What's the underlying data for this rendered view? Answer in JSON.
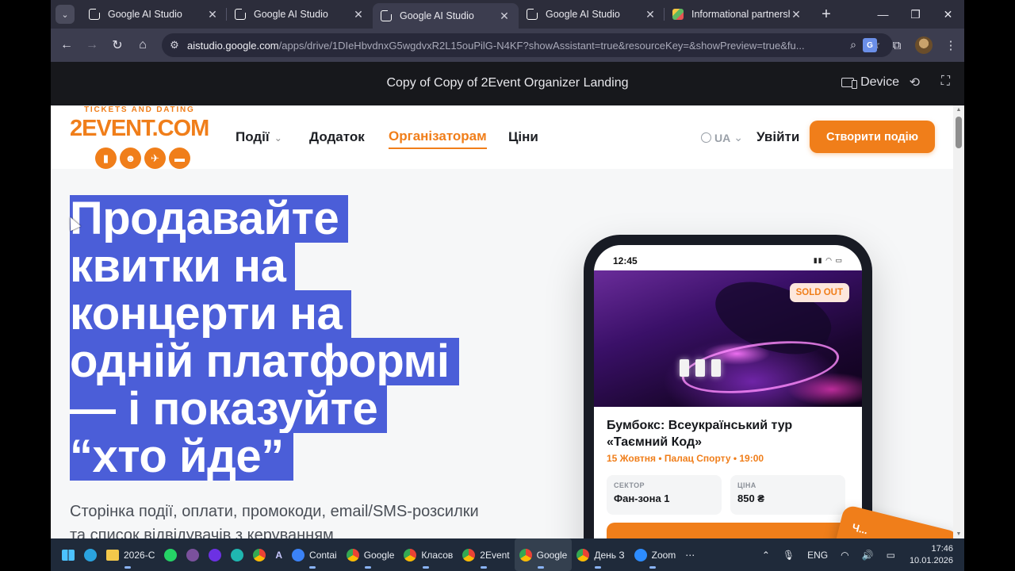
{
  "browser": {
    "tabs": [
      {
        "title": "Google AI Studio",
        "active": false
      },
      {
        "title": "Google AI Studio",
        "active": false
      },
      {
        "title": "Google AI Studio",
        "active": true
      },
      {
        "title": "Google AI Studio",
        "active": false
      },
      {
        "title": "Informational partnership",
        "active": false
      }
    ],
    "url_host": "aistudio.google.com",
    "url_path": "/apps/drive/1DIeHbvdnxG5wgdvxR2L15ouPilG-N4KF?showAssistant=true&resourceKey=&showPreview=true&fu..."
  },
  "preview": {
    "title": "Copy of Copy of 2Event Organizer Landing",
    "device_label": "Device"
  },
  "site": {
    "logo_tagline": "TICKETS AND DATING",
    "logo_text": "2EVENT.COM",
    "nav": {
      "events": "Події",
      "app": "Додаток",
      "organizers": "Організаторам",
      "prices": "Ціни"
    },
    "lang": "UA",
    "login": "Увійти",
    "cta": "Створити подію",
    "hero_lines": [
      "Продавайте",
      "квитки на",
      "концерти на",
      "одній платформі",
      "— і показуйте",
      "“хто йде”"
    ],
    "hero_sub": "Сторінка події, оплати, промокоди, email/SMS-розсилки та список відвідувачів з керуванням"
  },
  "phone": {
    "time": "12:45",
    "badge": "SOLD OUT",
    "event_title": "Бумбокс: Всеукраїнський тур «Таємний Код»",
    "event_meta": "15 Жовтня • Палац Спорту • 19:00",
    "sector_label": "СЕКТОР",
    "sector_value": "Фан-зона 1",
    "price_label": "ЦІНА",
    "price_value": "850 ₴",
    "float_tag": "Ч..."
  },
  "taskbar": {
    "items": [
      "2026-С",
      "Contai",
      "Google",
      "Класов",
      "2Event",
      "Google",
      "День З",
      "Zoom"
    ],
    "lang": "ENG",
    "time": "17:46",
    "date": "10.01.2026"
  },
  "colors": {
    "accent": "#f07e1a",
    "selection": "#4b5ed8",
    "chrome_bg": "#3c3d4f"
  }
}
